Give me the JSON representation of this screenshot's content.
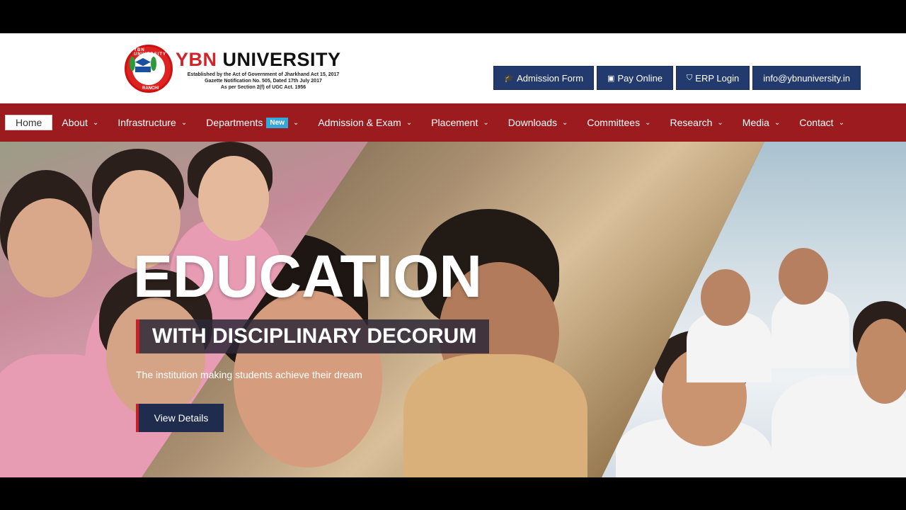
{
  "header": {
    "logo": {
      "title_red": "YBN",
      "title_dark": "UNIVERSITY",
      "seal_top": "YBN UNIVERSITY",
      "seal_bottom": "RANCHI",
      "lines": [
        "Established by the Act of Government of Jharkhand Act 15, 2017",
        "Gazette Notification No. 505, Dated 17th July 2017",
        "As per Section 2(f) of UGC Act. 1956"
      ]
    },
    "buttons": [
      {
        "icon": "graduation-cap-icon",
        "label": "Admission Form"
      },
      {
        "icon": "credit-card-icon",
        "label": "Pay Online"
      },
      {
        "icon": "shield-icon",
        "label": "ERP Login"
      },
      {
        "icon": "",
        "label": "info@ybnuniversity.in"
      }
    ]
  },
  "nav": {
    "items": [
      {
        "label": "Home",
        "active": true
      },
      {
        "label": "About"
      },
      {
        "label": "Infrastructure"
      },
      {
        "label": "Departments",
        "badge": "New"
      },
      {
        "label": "Admission & Exam"
      },
      {
        "label": "Placement"
      },
      {
        "label": "Downloads"
      },
      {
        "label": "Committees"
      },
      {
        "label": "Research"
      },
      {
        "label": "Media"
      },
      {
        "label": "Contact"
      }
    ]
  },
  "hero": {
    "title": "EDUCATION",
    "subtitle": "WITH DISCIPLINARY DECORUM",
    "tagline": "The institution making students achieve their dream",
    "button": "View Details"
  },
  "colors": {
    "nav_bg": "#9b1b1e",
    "button_bg": "#223a6e",
    "accent_red": "#c82027",
    "badge": "#35a7d9"
  }
}
